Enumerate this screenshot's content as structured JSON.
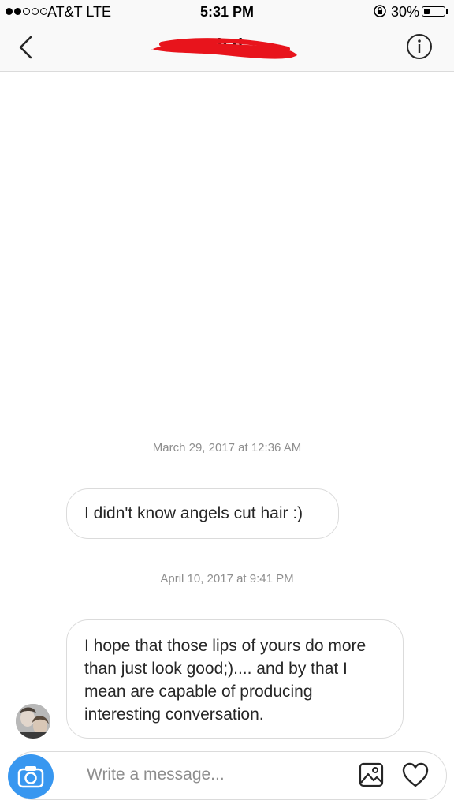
{
  "status_bar": {
    "signal_dots_filled": 2,
    "signal_dots_total": 5,
    "carrier": "AT&T  LTE",
    "time": "5:31 PM",
    "battery_percent_text": "30%",
    "battery_level": 0.3
  },
  "header": {
    "title": "th            d",
    "back_icon": "chevron-left-icon",
    "info_icon": "info-icon",
    "redaction_color": "#e8141c"
  },
  "messages": [
    {
      "timestamp": "March 29, 2017 at 12:36 AM",
      "text": "I didn't know angels cut hair :)"
    },
    {
      "timestamp": "April 10, 2017 at 9:41 PM",
      "text": "I hope that those lips of yours do more than just look good;).... and by that I mean are capable  of producing interesting conversation."
    }
  ],
  "composer": {
    "placeholder": "Write a message...",
    "camera_icon": "camera-icon",
    "gallery_icon": "gallery-icon",
    "heart_icon": "heart-icon",
    "accent_color": "#3897f0"
  }
}
